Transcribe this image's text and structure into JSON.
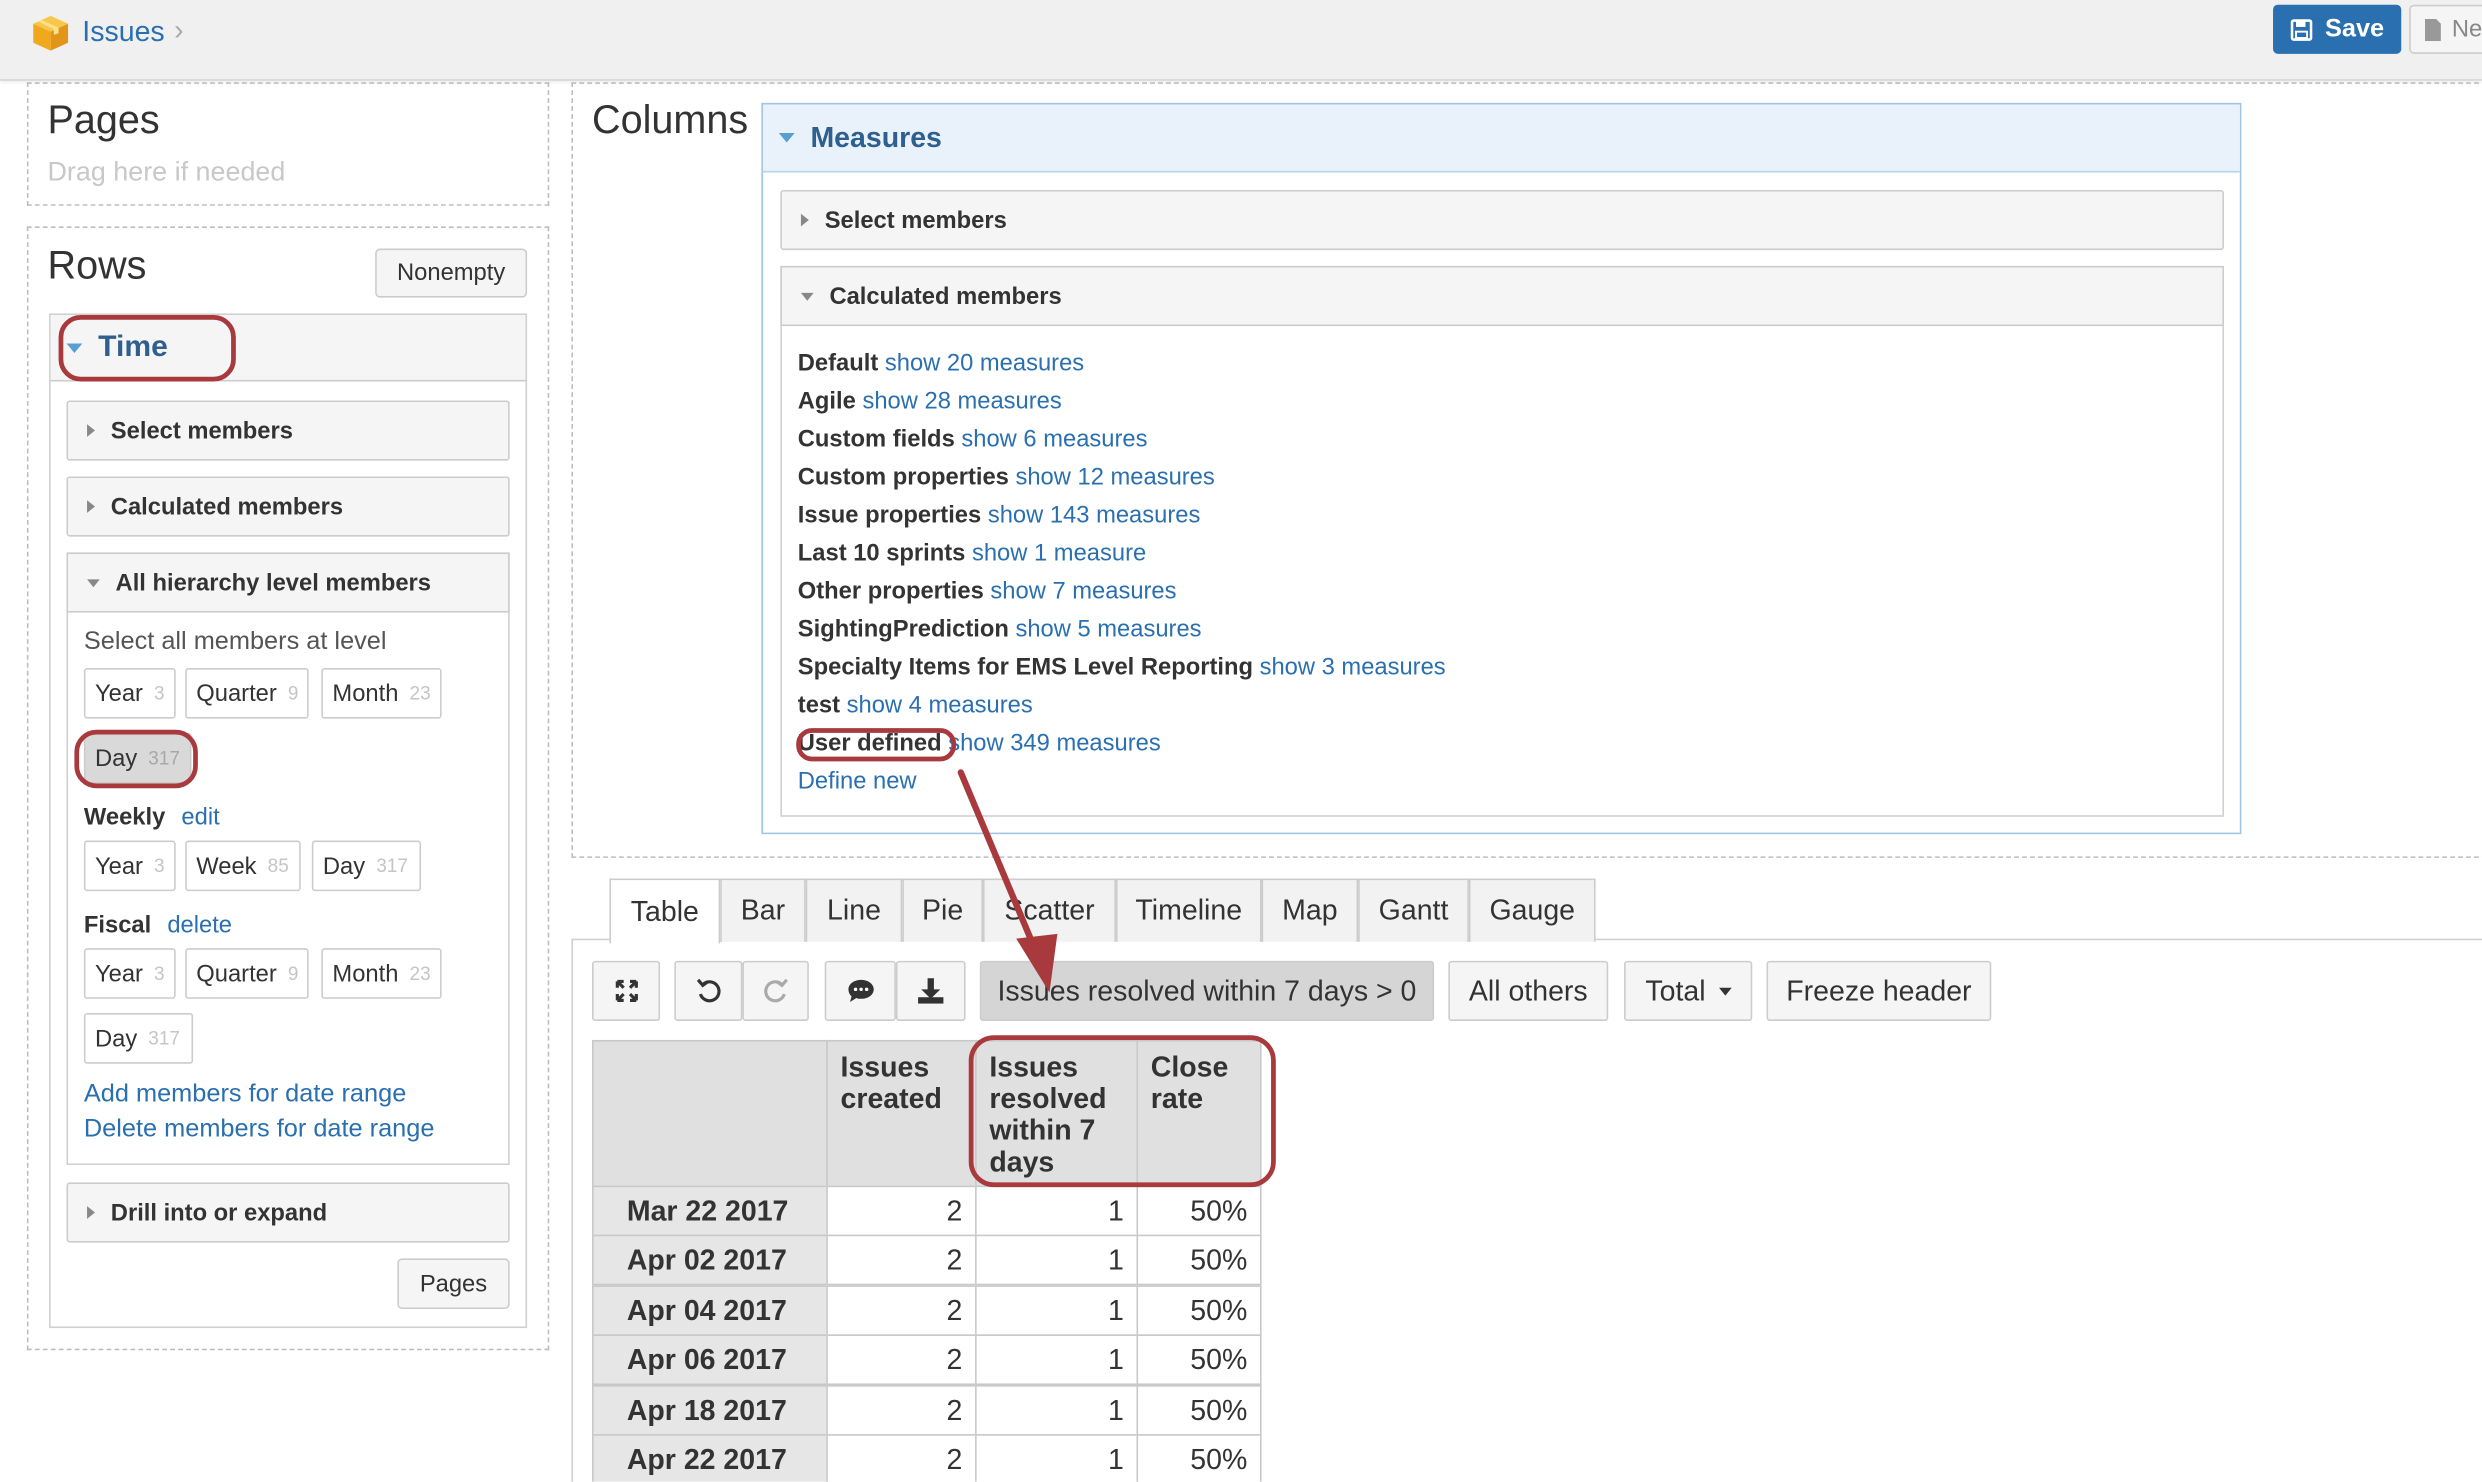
{
  "header": {
    "breadcrumb_label": "Issues",
    "save_label": "Save",
    "new_label": "Ne"
  },
  "pages": {
    "title": "Pages",
    "hint": "Drag here if needed"
  },
  "rows": {
    "title": "Rows",
    "nonempty_label": "Nonempty",
    "dimension": "Time",
    "select_members": "Select members",
    "calculated_members": "Calculated members",
    "all_levels": "All hierarchy level members",
    "select_all_label": "Select all members at level",
    "default_levels": [
      {
        "name": "Year",
        "count": "3"
      },
      {
        "name": "Quarter",
        "count": "9"
      },
      {
        "name": "Month",
        "count": "23"
      },
      {
        "name": "Day",
        "count": "317"
      }
    ],
    "weekly": {
      "label": "Weekly",
      "action": "edit",
      "levels": [
        {
          "name": "Year",
          "count": "3"
        },
        {
          "name": "Week",
          "count": "85"
        },
        {
          "name": "Day",
          "count": "317"
        }
      ]
    },
    "fiscal": {
      "label": "Fiscal",
      "action": "delete",
      "levels": [
        {
          "name": "Year",
          "count": "3"
        },
        {
          "name": "Quarter",
          "count": "9"
        },
        {
          "name": "Month",
          "count": "23"
        },
        {
          "name": "Day",
          "count": "317"
        }
      ]
    },
    "add_range": "Add members for date range",
    "delete_range": "Delete members for date range",
    "drill": "Drill into or expand",
    "pages_btn": "Pages"
  },
  "columns": {
    "title": "Columns",
    "dimension": "Measures",
    "select_members": "Select members",
    "calculated_members": "Calculated members",
    "calc_groups": [
      {
        "name": "Default",
        "link": "show 20 measures"
      },
      {
        "name": "Agile",
        "link": "show 28 measures"
      },
      {
        "name": "Custom fields",
        "link": "show 6 measures"
      },
      {
        "name": "Custom properties",
        "link": "show 12 measures"
      },
      {
        "name": "Issue properties",
        "link": "show 143 measures"
      },
      {
        "name": "Last 10 sprints",
        "link": "show 1 measure"
      },
      {
        "name": "Other properties",
        "link": "show 7 measures"
      },
      {
        "name": "SightingPrediction",
        "link": "show 5 measures"
      },
      {
        "name": "Specialty Items for EMS Level Reporting",
        "link": "show 3 measures"
      },
      {
        "name": "test",
        "link": "show 4 measures"
      },
      {
        "name": "User defined",
        "link": "show 349 measures"
      }
    ],
    "define_new": "Define new"
  },
  "tabs": [
    "Table",
    "Bar",
    "Line",
    "Pie",
    "Scatter",
    "Timeline",
    "Map",
    "Gantt",
    "Gauge"
  ],
  "active_tab": "Table",
  "toolbar": {
    "filter_label": "Issues resolved within 7 days > 0",
    "all_others": "All others",
    "total": "Total",
    "freeze": "Freeze header"
  },
  "table": {
    "columns": [
      "Issues created",
      "Issues resolved within 7 days",
      "Close rate"
    ],
    "rows": [
      {
        "label": "Mar 22 2017",
        "values": [
          "2",
          "1",
          "50%"
        ]
      },
      {
        "label": "Apr 02 2017",
        "values": [
          "2",
          "1",
          "50%"
        ]
      },
      {
        "label": "Apr 04 2017",
        "values": [
          "2",
          "1",
          "50%"
        ]
      },
      {
        "label": "Apr 06 2017",
        "values": [
          "2",
          "1",
          "50%"
        ]
      },
      {
        "label": "Apr 18 2017",
        "values": [
          "2",
          "1",
          "50%"
        ]
      },
      {
        "label": "Apr 22 2017",
        "values": [
          "2",
          "1",
          "50%"
        ]
      }
    ]
  },
  "colors": {
    "link": "#2a6fb0",
    "save_bg": "#2a6fb0",
    "annotation_red": "#a83a3e",
    "header_bg": "#e0e0e0"
  }
}
